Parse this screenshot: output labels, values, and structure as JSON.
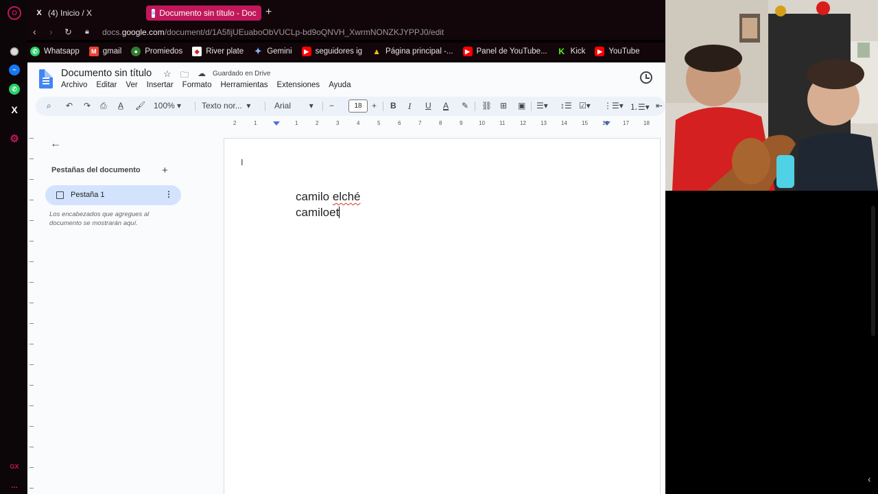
{
  "browser": {
    "tabs": [
      {
        "label": "(4) Inicio / X",
        "icon": "x-icon",
        "active": false
      },
      {
        "label": "Documento sin título - Doc",
        "icon": "docs-icon",
        "active": true
      }
    ],
    "new_tab": "+",
    "url_prefix": "docs.",
    "url_domain": "google.com",
    "url_path": "/document/d/1A5fijUEuaboObVUCLp-bd9oQNVH_XwrmNONZKJYPPJ0/edit",
    "bookmarks": [
      {
        "label": "Whatsapp",
        "color": "#25d366"
      },
      {
        "label": "gmail",
        "color": "#ea4335"
      },
      {
        "label": "Promiedos",
        "color": "#2e7d32"
      },
      {
        "label": "River plate",
        "color": "#c62828"
      },
      {
        "label": "Gemini",
        "color": "#8ab4f8"
      },
      {
        "label": "seguidores ig",
        "color": "#ff0000"
      },
      {
        "label": "Página principal -...",
        "color": "#fbbc05"
      },
      {
        "label": "Panel de YouTube...",
        "color": "#ff0000"
      },
      {
        "label": "Kick",
        "color": "#53fc18"
      },
      {
        "label": "YouTube",
        "color": "#ff0000"
      }
    ]
  },
  "side_rail": {
    "bottom_label": "GX",
    "more": "..."
  },
  "docs": {
    "title": "Documento sin título",
    "saved_status": "Guardado en Drive",
    "menus": [
      "Archivo",
      "Editar",
      "Ver",
      "Insertar",
      "Formato",
      "Herramientas",
      "Extensiones",
      "Ayuda"
    ],
    "toolbar": {
      "zoom": "100%",
      "style": "Texto nor...",
      "font": "Arial",
      "font_size": "18",
      "minus": "−",
      "plus": "+",
      "bold": "B",
      "italic": "I",
      "underline": "U",
      "text_color": "A"
    },
    "ruler_numbers": [
      "2",
      "1",
      "1",
      "2",
      "3",
      "4",
      "5",
      "6",
      "7",
      "8",
      "9",
      "10",
      "11",
      "12",
      "13",
      "14",
      "15",
      "16",
      "17",
      "18"
    ],
    "outline": {
      "title": "Pestañas del documento",
      "add": "+",
      "tab_label": "Pestaña 1",
      "hint": "Los encabezados que agregues al documento se mostrarán aquí."
    },
    "body": {
      "line1_word1": "camilo",
      "line1_word2": "elché",
      "line2": "camiloet"
    }
  },
  "colors": {
    "accent": "#c2185b",
    "docs_blue": "#4285f4",
    "tab_pill": "#d3e3fd",
    "toolbar_bg": "#edf2fa"
  }
}
